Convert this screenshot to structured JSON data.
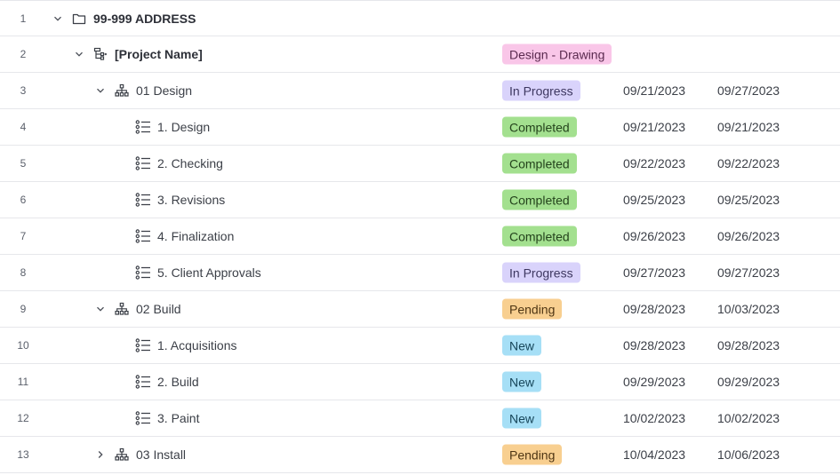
{
  "rows": [
    {
      "num": "1",
      "label": "99-999 ADDRESS"
    },
    {
      "num": "2",
      "label": "[Project Name]",
      "status": "Design - Drawing"
    },
    {
      "num": "3",
      "label": "01 Design",
      "status": "In Progress",
      "start": "09/21/2023",
      "end": "09/27/2023"
    },
    {
      "num": "4",
      "label": "1. Design",
      "status": "Completed",
      "start": "09/21/2023",
      "end": "09/21/2023"
    },
    {
      "num": "5",
      "label": "2. Checking",
      "status": "Completed",
      "start": "09/22/2023",
      "end": "09/22/2023"
    },
    {
      "num": "6",
      "label": "3. Revisions",
      "status": "Completed",
      "start": "09/25/2023",
      "end": "09/25/2023"
    },
    {
      "num": "7",
      "label": "4. Finalization",
      "status": "Completed",
      "start": "09/26/2023",
      "end": "09/26/2023"
    },
    {
      "num": "8",
      "label": "5. Client Approvals",
      "status": "In Progress",
      "start": "09/27/2023",
      "end": "09/27/2023"
    },
    {
      "num": "9",
      "label": "02 Build",
      "status": "Pending",
      "start": "09/28/2023",
      "end": "10/03/2023"
    },
    {
      "num": "10",
      "label": "1. Acquisitions",
      "status": "New",
      "start": "09/28/2023",
      "end": "09/28/2023"
    },
    {
      "num": "11",
      "label": "2. Build",
      "status": "New",
      "start": "09/29/2023",
      "end": "09/29/2023"
    },
    {
      "num": "12",
      "label": "3. Paint",
      "status": "New",
      "start": "10/02/2023",
      "end": "10/02/2023"
    },
    {
      "num": "13",
      "label": "03 Install",
      "status": "Pending",
      "start": "10/04/2023",
      "end": "10/06/2023"
    }
  ],
  "icons": {
    "folder": "folder-icon",
    "project": "project-icon",
    "phase": "hierarchy-icon",
    "task": "task-list-icon",
    "expanded": "chevron-down-icon",
    "collapsed": "chevron-right-icon"
  },
  "colors": {
    "design_drawing": "#f9c6e8",
    "in_progress": "#d9d3fb",
    "completed": "#a3e08f",
    "pending": "#f8cf90",
    "new": "#a6dff6"
  }
}
